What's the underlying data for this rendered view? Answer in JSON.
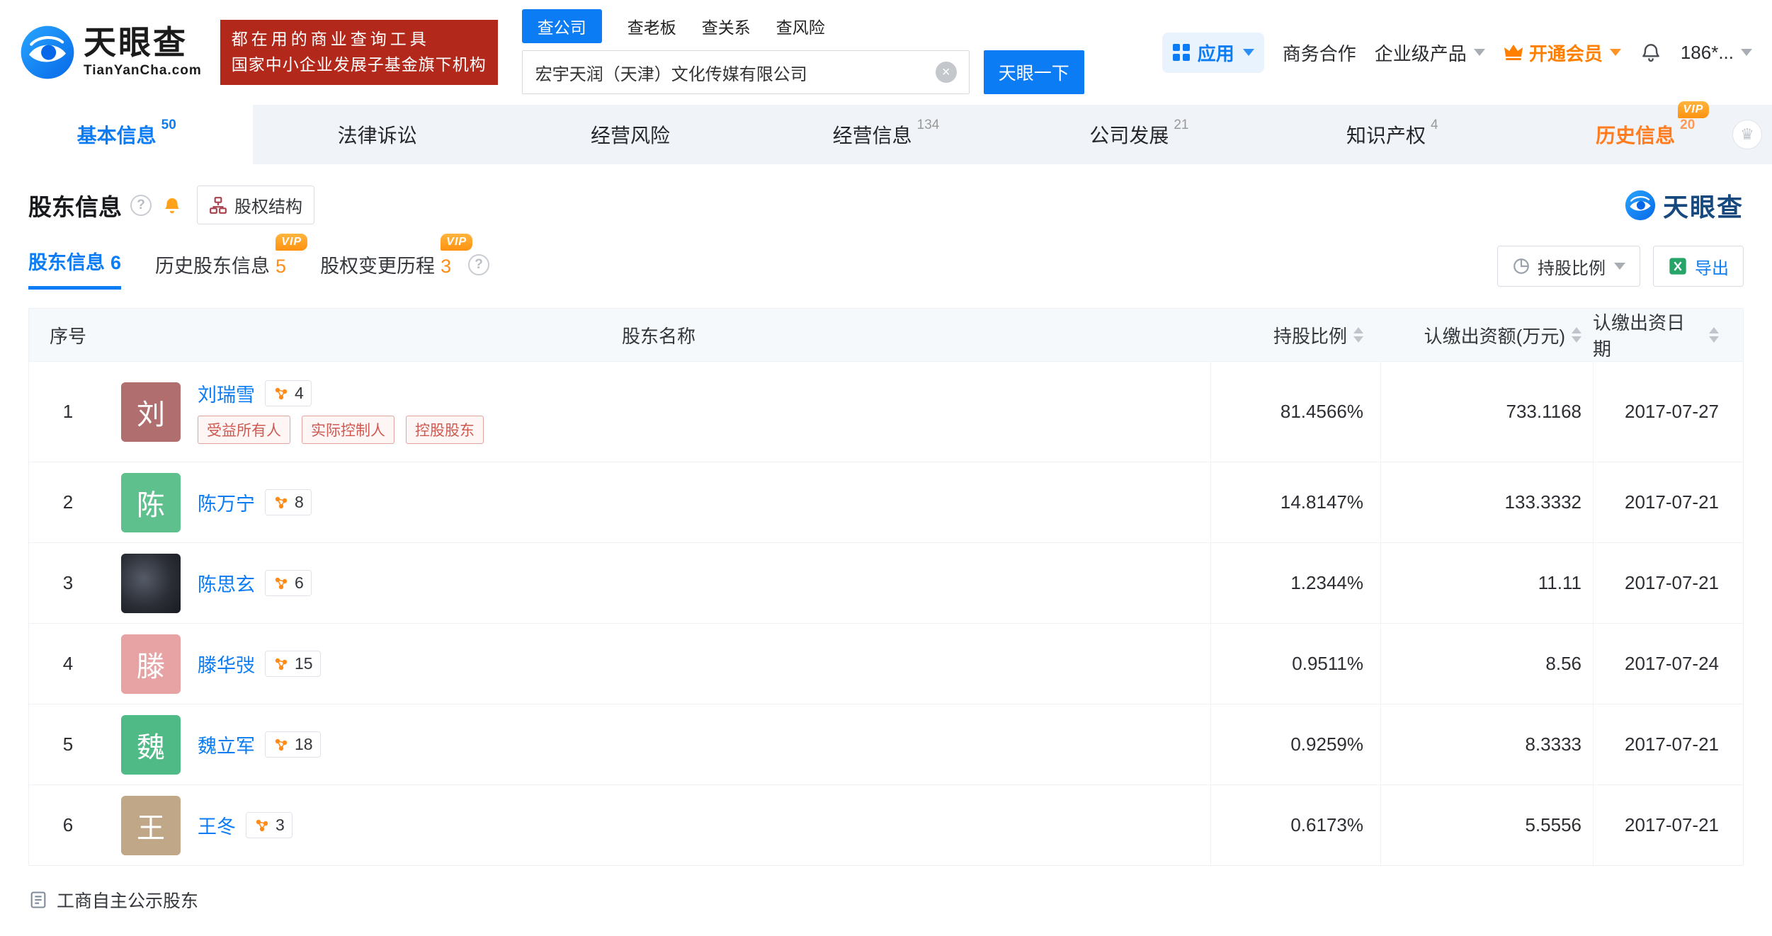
{
  "misc": {
    "vip": "VIP"
  },
  "colors": {
    "primary": "#0b7cf4",
    "promo_red": "#b2291c",
    "vip_orange": "#ff9210",
    "history_tab_orange": "#ff7c21",
    "tag_red": "#cf5a52"
  },
  "brand": {
    "name": "天眼查",
    "domain": "TianYanCha.com"
  },
  "promo": {
    "line1": "都在用的商业查询工具",
    "line2": "国家中小企业发展子基金旗下机构"
  },
  "search": {
    "tabs": [
      {
        "label": "查公司",
        "active": true
      },
      {
        "label": "查老板",
        "active": false
      },
      {
        "label": "查关系",
        "active": false
      },
      {
        "label": "查风险",
        "active": false
      }
    ],
    "value": "宏宇天润（天津）文化传媒有限公司",
    "submit": "天眼一下"
  },
  "topmenu": {
    "apps": "应用",
    "cooperation": "商务合作",
    "enterprise": "企业级产品",
    "vip": "开通会员",
    "account": "186*..."
  },
  "nav": {
    "tabs": [
      {
        "label": "基本信息",
        "count": "50"
      },
      {
        "label": "法律诉讼",
        "count": ""
      },
      {
        "label": "经营风险",
        "count": ""
      },
      {
        "label": "经营信息",
        "count": "134"
      },
      {
        "label": "公司发展",
        "count": "21"
      },
      {
        "label": "知识产权",
        "count": "4"
      },
      {
        "label": "历史信息",
        "count": "20"
      }
    ]
  },
  "section": {
    "title": "股东信息",
    "equity_structure": "股权结构",
    "watermark": "天眼查",
    "subtabs": [
      {
        "label": "股东信息",
        "count": "6"
      },
      {
        "label": "历史股东信息",
        "count": "5"
      },
      {
        "label": "股权变更历程",
        "count": "3"
      }
    ],
    "ratio_filter": "持股比例",
    "export": "导出"
  },
  "table": {
    "headers": {
      "index": "序号",
      "name": "股东名称",
      "ratio": "持股比例",
      "amount": "认缴出资额(万元)",
      "date": "认缴出资日期"
    },
    "rows": [
      {
        "index": "1",
        "name": "刘瑞雪",
        "avatar": "刘",
        "avatar_color": "#b06e6e",
        "badge": "4",
        "tags": [
          "受益所有人",
          "实际控制人",
          "控股股东"
        ],
        "ratio": "81.4566%",
        "amount": "733.1168",
        "date": "2017-07-27"
      },
      {
        "index": "2",
        "name": "陈万宁",
        "avatar": "陈",
        "avatar_color": "#5ec08d",
        "badge": "8",
        "ratio": "14.8147%",
        "amount": "133.3332",
        "date": "2017-07-21"
      },
      {
        "index": "3",
        "name": "陈思玄",
        "avatar": "",
        "avatar_color": "",
        "badge": "6",
        "ratio": "1.2344%",
        "amount": "11.11",
        "date": "2017-07-21"
      },
      {
        "index": "4",
        "name": "滕华弢",
        "avatar": "滕",
        "avatar_color": "#e7a3a3",
        "badge": "15",
        "ratio": "0.9511%",
        "amount": "8.56",
        "date": "2017-07-24"
      },
      {
        "index": "5",
        "name": "魏立军",
        "avatar": "魏",
        "avatar_color": "#4fba86",
        "badge": "18",
        "ratio": "0.9259%",
        "amount": "8.3333",
        "date": "2017-07-21"
      },
      {
        "index": "6",
        "name": "王冬",
        "avatar": "王",
        "avatar_color": "#c0a787",
        "badge": "3",
        "ratio": "0.6173%",
        "amount": "5.5556",
        "date": "2017-07-21"
      }
    ],
    "footer_note": "工商自主公示股东"
  }
}
